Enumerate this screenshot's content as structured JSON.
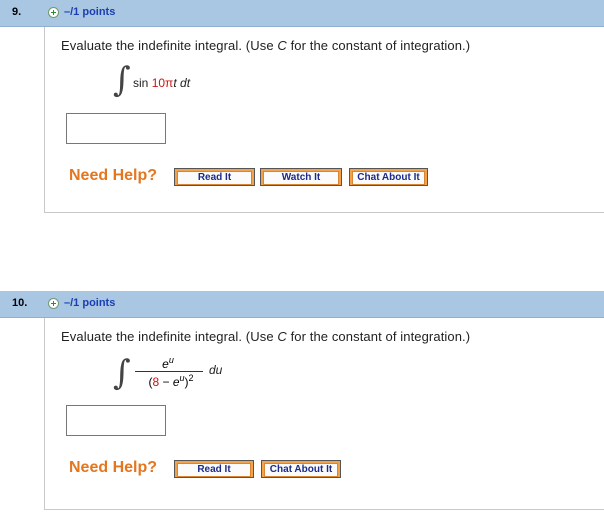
{
  "questions": [
    {
      "number": "9.",
      "points": "–/1 points",
      "prompt_before": "Evaluate the indefinite integral. (Use ",
      "prompt_var": "C",
      "prompt_after": " for the constant of integration.)",
      "integrand": {
        "func": "sin",
        "coef": "10",
        "pi": "π",
        "var": "t",
        "differential": "dt"
      },
      "answer_value": "",
      "need_help": "Need Help?",
      "buttons": [
        "Read It",
        "Watch It",
        "Chat About It"
      ]
    },
    {
      "number": "10.",
      "points": "–/1 points",
      "prompt_before": "Evaluate the indefinite integral. (Use ",
      "prompt_var": "C",
      "prompt_after": " for the constant of integration.)",
      "integrand": {
        "num_base": "e",
        "num_exp": "u",
        "den_open": "(",
        "den_const": "8",
        "den_minus": " − ",
        "den_base": "e",
        "den_exp": "u",
        "den_close": ")",
        "den_power": "2",
        "differential": "du"
      },
      "answer_value": "",
      "need_help": "Need Help?",
      "buttons": [
        "Read It",
        "Chat About It"
      ]
    }
  ],
  "colors": {
    "header_bar": "#a9c6e3",
    "points_text": "#1b3fb0",
    "need_help": "#e4761f",
    "button_orange": "#f3a24c",
    "button_text": "#1a2b8a",
    "constant_red": "#cc1111"
  },
  "icons": {
    "expand": "plus-circle-icon",
    "integral": "integral-sign-icon"
  }
}
